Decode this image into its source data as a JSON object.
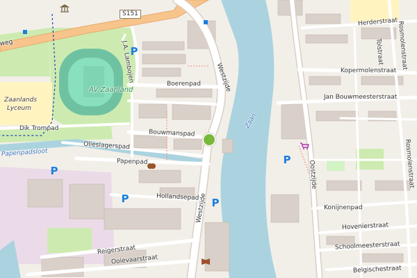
{
  "map": {
    "road_shield": "S151",
    "labels": {
      "westzijde_n": "Westzijde",
      "westzijde_s": "Westzijde",
      "boerenpad": "Boerenpad",
      "bouwmanspad": "Bouwmanspad",
      "olieslagerspad": "Olieslagerspad",
      "papenpad": "Papenpad",
      "papenpadsloot": "Papenpadsloot",
      "hollandsepad": "Hollandsepad",
      "reigerstraat": "Reigerstraat",
      "ooievaarstraat": "Ooievaarstraat",
      "lambojen": "J.A. Lambojen",
      "av_zaanland": "AV Zaanland",
      "zaanlands_lyceum_1": "Zaanlands",
      "zaanlands_lyceum_2": "Lyceum",
      "dik_trompad": "Dik Trompad",
      "weg": "weg",
      "zaan": "Zaan",
      "herderstraat": "Herderstraat",
      "tolstraat": "Tolstraat",
      "rosmolenstraat_1": "Rosmolenstraat",
      "rosmolenstraat_2": "Rosmolenstraat",
      "kopermolenstraat": "Kopermolenstraat",
      "jan_bouwmeesterstraat": "Jan Bouwmeesterstraat",
      "oostzijde": "Oostzijde",
      "konijnenpad": "Konijnenpad",
      "hovenierstraat": "Hovenierstraat",
      "schoolmeesterstraat": "Schoolmeesterstraat",
      "belgischestraat": "Belgischestraat"
    },
    "parking_symbol": "P",
    "icons": [
      "parking-icon",
      "theatre-icon",
      "library-icon",
      "shop-icon",
      "courthouse-icon",
      "bus-stop-icon"
    ],
    "colors": {
      "background": "#f2efe9",
      "water": "#aad3df",
      "park": "#c8facc",
      "pitch": "#88e0be",
      "track": "#6fc2a1",
      "building": "#d9d0c9",
      "motorway": "#f7c58c",
      "primary_road": "#ffffff",
      "industrial": "#ebdbe8",
      "school": "#fff4c0",
      "parking_blue": "#1c7ee0",
      "roundabout": "#7ab83b"
    }
  }
}
